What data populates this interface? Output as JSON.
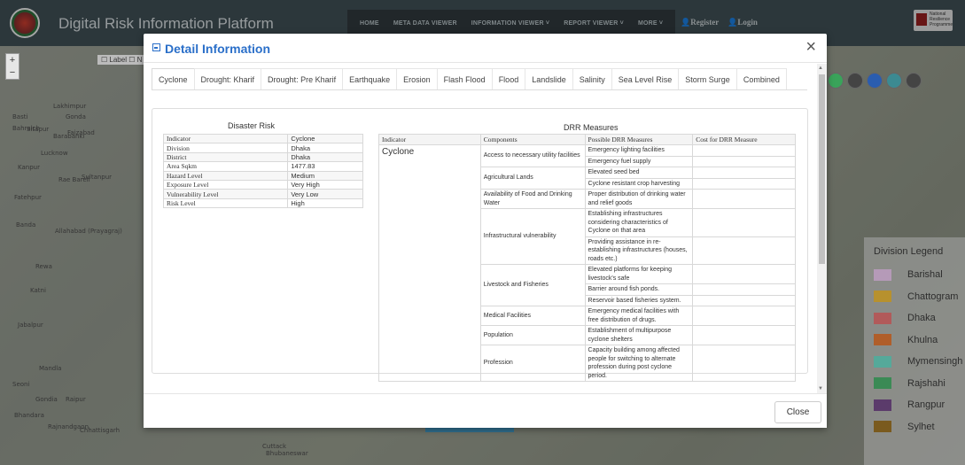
{
  "header": {
    "app_title": "Digital Risk Information Platform",
    "nav": [
      "HOME",
      "META DATA VIEWER",
      "INFORMATION VIEWER ˅",
      "REPORT VIEWER ˅",
      "MORE ˅"
    ],
    "register": "Register",
    "login": "Login",
    "partner_logo_text": "National Resilience Programme"
  },
  "map": {
    "zoom_in": "+",
    "zoom_out": "−",
    "label_toggle": "☐ Label ☐ N",
    "places": [
      "Lakhimpur",
      "Bahraich",
      "Basti",
      "Sitapur",
      "Gonda",
      "Barabanki",
      "Faizabad",
      "Lucknow",
      "Kanpur",
      "Rae Bareli",
      "Sultanpur",
      "Fatehpur",
      "Banda",
      "Allahabad (Prayagraj)",
      "Rewa",
      "Katni",
      "Jabalpur",
      "Mandla",
      "Seoni",
      "Gondia",
      "Raipur",
      "Bhandara",
      "Rajnandgaon",
      "Chhattisgarh",
      "Cuttack",
      "Bhubaneswar"
    ]
  },
  "legend": {
    "title": "Division Legend",
    "items": [
      {
        "label": "Barishal",
        "color": "#b59ab8"
      },
      {
        "label": "Chattogram",
        "color": "#b7912e"
      },
      {
        "label": "Dhaka",
        "color": "#b15a5a"
      },
      {
        "label": "Khulna",
        "color": "#b05e2a"
      },
      {
        "label": "Mymensingh",
        "color": "#55a99a"
      },
      {
        "label": "Rajshahi",
        "color": "#3b8a55"
      },
      {
        "label": "Rangpur",
        "color": "#5b3b6b"
      },
      {
        "label": "Sylhet",
        "color": "#7a5a1e"
      }
    ]
  },
  "modal": {
    "title": "Detail Information",
    "close_icon": "×",
    "tabs": [
      "Cyclone",
      "Drought: Kharif",
      "Drought: Pre Kharif",
      "Earthquake",
      "Erosion",
      "Flash Flood",
      "Flood",
      "Landslide",
      "Salinity",
      "Sea Level Rise",
      "Storm Surge",
      "Combined"
    ],
    "close_button": "Close",
    "disaster_risk": {
      "title": "Disaster Risk",
      "rows": [
        [
          "Indicator",
          "Cyclone"
        ],
        [
          "Division",
          "Dhaka"
        ],
        [
          "District",
          "Dhaka"
        ],
        [
          "Area Sqkm",
          "1477.83"
        ],
        [
          "Hazard Level",
          "Medium"
        ],
        [
          "Exposure Level",
          "Very High"
        ],
        [
          "Vulnerability Level",
          "Very Low"
        ],
        [
          "Risk Level",
          "High"
        ]
      ]
    },
    "drr": {
      "title": "DRR Measures",
      "headers": [
        "Indicator",
        "Components",
        "Possible DRR Measures",
        "Cost for DRR Measure"
      ],
      "indicator": "Cyclone",
      "groups": [
        {
          "component": "Access to necessary utility facilities",
          "measures": [
            "Emergency lighting facilities",
            "Emergency fuel supply"
          ]
        },
        {
          "component": "Agricultural Lands",
          "measures": [
            "Elevated seed bed",
            "Cyclone resistant crop harvesting"
          ]
        },
        {
          "component": "Availability of Food and Drinking Water",
          "measures": [
            "Proper distribution of drinking water and relief goods"
          ]
        },
        {
          "component": "Infrastructural vulnerability",
          "measures": [
            "Establishing infrastructures considering characteristics of Cyclone on that area",
            "Providing assistance in re-establishing infrastructures (houses, roads etc.)"
          ]
        },
        {
          "component": "Livestock and Fisheries",
          "measures": [
            "Elevated platforms for keeping livestock's safe",
            "Barrier around fish ponds.",
            "Reservoir based fisheries system."
          ]
        },
        {
          "component": "Medical Facilities",
          "measures": [
            "Emergency medical facilities with free distribution of drugs."
          ]
        },
        {
          "component": "Population",
          "measures": [
            "Establishment of multipurpose cyclone shelters"
          ]
        },
        {
          "component": "Profession",
          "measures": [
            "Capacity building among affected people for switching to alternate profession during post cyclone period."
          ]
        }
      ]
    }
  }
}
